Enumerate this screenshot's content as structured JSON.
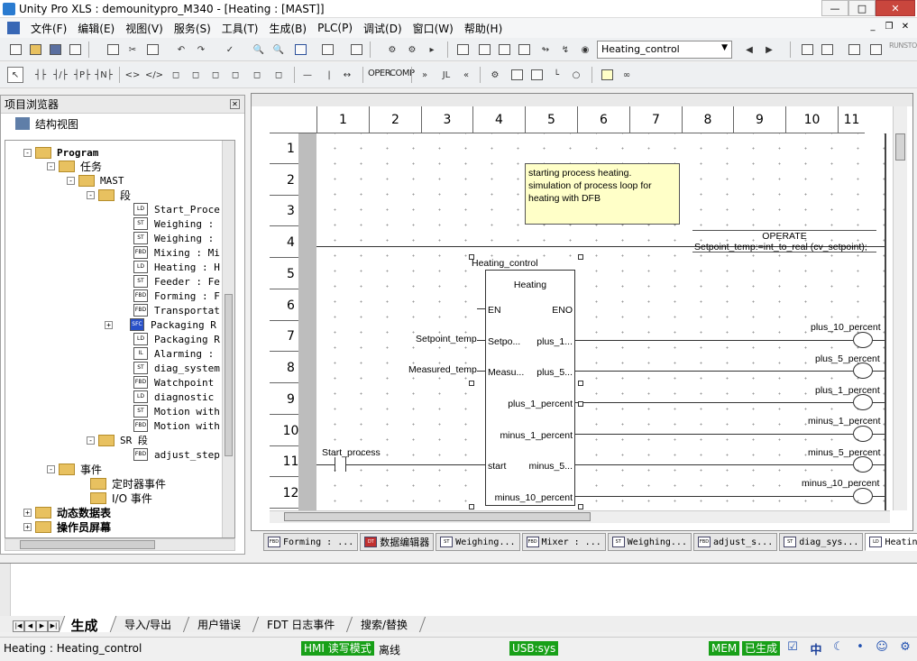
{
  "window": {
    "title": "Unity Pro XLS : demounitypro_M340 - [Heating : [MAST]]"
  },
  "menu": [
    "文件(F)",
    "编辑(E)",
    "视图(V)",
    "服务(S)",
    "工具(T)",
    "生成(B)",
    "PLC(P)",
    "调试(D)",
    "窗口(W)",
    "帮助(H)"
  ],
  "toolbar": {
    "section_combo": "Heating_control",
    "oper_label": "OPER",
    "comp_label": "COMP",
    "run_label": "RUN",
    "stop_label": "STOP"
  },
  "browser": {
    "title": "项目浏览器",
    "view_label": "结构视图",
    "tree": [
      {
        "label": "Program",
        "bold": true
      },
      {
        "label": "任务"
      },
      {
        "label": "MAST"
      },
      {
        "label": "段"
      },
      {
        "icon": "LD",
        "label": "Start_Proce"
      },
      {
        "icon": "ST",
        "label": "Weighing :"
      },
      {
        "icon": "ST",
        "label": "Weighing :"
      },
      {
        "icon": "FBD",
        "label": "Mixing : Mi"
      },
      {
        "icon": "LD",
        "label": "Heating : H"
      },
      {
        "icon": "ST",
        "label": "Feeder : Fe"
      },
      {
        "icon": "FBD",
        "label": "Forming : F"
      },
      {
        "icon": "FBD",
        "label": "Transportat"
      },
      {
        "icon": "SFC",
        "label": "Packaging R"
      },
      {
        "icon": "LD",
        "label": "Packaging R"
      },
      {
        "icon": "IL",
        "label": "Alarming :"
      },
      {
        "icon": "ST",
        "label": "diag_system"
      },
      {
        "icon": "FBD",
        "label": "Watchpoint"
      },
      {
        "icon": "LD",
        "label": "diagnostic"
      },
      {
        "icon": "ST",
        "label": "Motion with"
      },
      {
        "icon": "FBD",
        "label": "Motion with"
      },
      {
        "label": "SR 段"
      },
      {
        "icon": "FBD",
        "label": "adjust_step"
      },
      {
        "label": "事件"
      },
      {
        "label": "定时器事件"
      },
      {
        "label": "I/O 事件"
      },
      {
        "label": "动态数据表",
        "bold": true
      },
      {
        "label": "操作员屏幕",
        "bold": true
      }
    ]
  },
  "editor": {
    "columns": [
      "1",
      "2",
      "3",
      "4",
      "5",
      "6",
      "7",
      "8",
      "9",
      "10",
      "11"
    ],
    "rows": [
      "1",
      "2",
      "3",
      "4",
      "5",
      "6",
      "7",
      "8",
      "9",
      "10",
      "11",
      "12"
    ],
    "comment": [
      "starting process heating.",
      "simulation of process loop for",
      "heating with DFB"
    ],
    "operate": {
      "title": "OPERATE",
      "expr": "Setpoint_temp:=int_to_real (cv_setpoint);"
    },
    "fb": {
      "instance": "Heating_control",
      "type": "Heating",
      "pin_en": "EN",
      "pin_eno": "ENO",
      "pin_setpoint": "Setpo...",
      "pin_measured": "Measu...",
      "pin_start": "start",
      "out_plus1": "plus_1...",
      "out_plus5": "plus_5...",
      "out_plus1_full": "plus_1_percent",
      "out_minus1": "minus_1_percent",
      "out_minus5": "minus_5...",
      "out_minus10": "minus_10_percent"
    },
    "in_setpoint": "Setpoint_temp",
    "in_measured": "Measured_temp",
    "contact": "Start_process",
    "coils": [
      "plus_10_percent",
      "plus_5_percent",
      "plus_1_percent",
      "minus_1_percent",
      "minus_5_percent",
      "minus_10_percent"
    ]
  },
  "doc_tabs": [
    {
      "icon": "FBD",
      "label": "Forming : ..."
    },
    {
      "icon": "DT",
      "label": "数据编辑器"
    },
    {
      "icon": "ST",
      "label": "Weighing..."
    },
    {
      "icon": "FBD",
      "label": "Mixer : ..."
    },
    {
      "icon": "ST",
      "label": "Weighing..."
    },
    {
      "icon": "FBD",
      "label": "adjust_s..."
    },
    {
      "icon": "ST",
      "label": "diag_sys..."
    },
    {
      "icon": "LD",
      "label": "Heating ..."
    }
  ],
  "output_tabs": [
    "生成",
    "导入/导出",
    "用户错误",
    "FDT 日志事件",
    "搜索/替换"
  ],
  "status": {
    "left": "Heating : Heating_control",
    "hmi": "HMI 读写模式",
    "offline": "离线",
    "usb": "USB:sys",
    "mem": "MEM",
    "built": "已生成",
    "ime": "中"
  },
  "colors": {
    "status_green": "#18a018",
    "comment_bg": "#ffffc8"
  }
}
